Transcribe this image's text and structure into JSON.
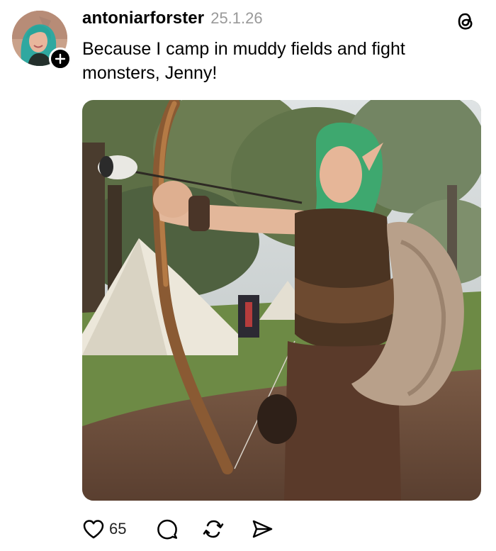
{
  "post": {
    "username": "antoniarforster",
    "timestamp": "25.1.26",
    "caption": "Because I camp in muddy fields and fight monsters, Jenny!",
    "likes": "65"
  },
  "image": {
    "description_tag": "photo",
    "icon": "photo-icon"
  },
  "icons": {
    "follow": "plus-icon",
    "app": "threads-logo-icon",
    "like": "heart-icon",
    "comment": "comment-icon",
    "repost": "repost-icon",
    "share": "share-icon"
  },
  "colors": {
    "text": "#000000",
    "muted": "#999999",
    "background": "#ffffff"
  }
}
